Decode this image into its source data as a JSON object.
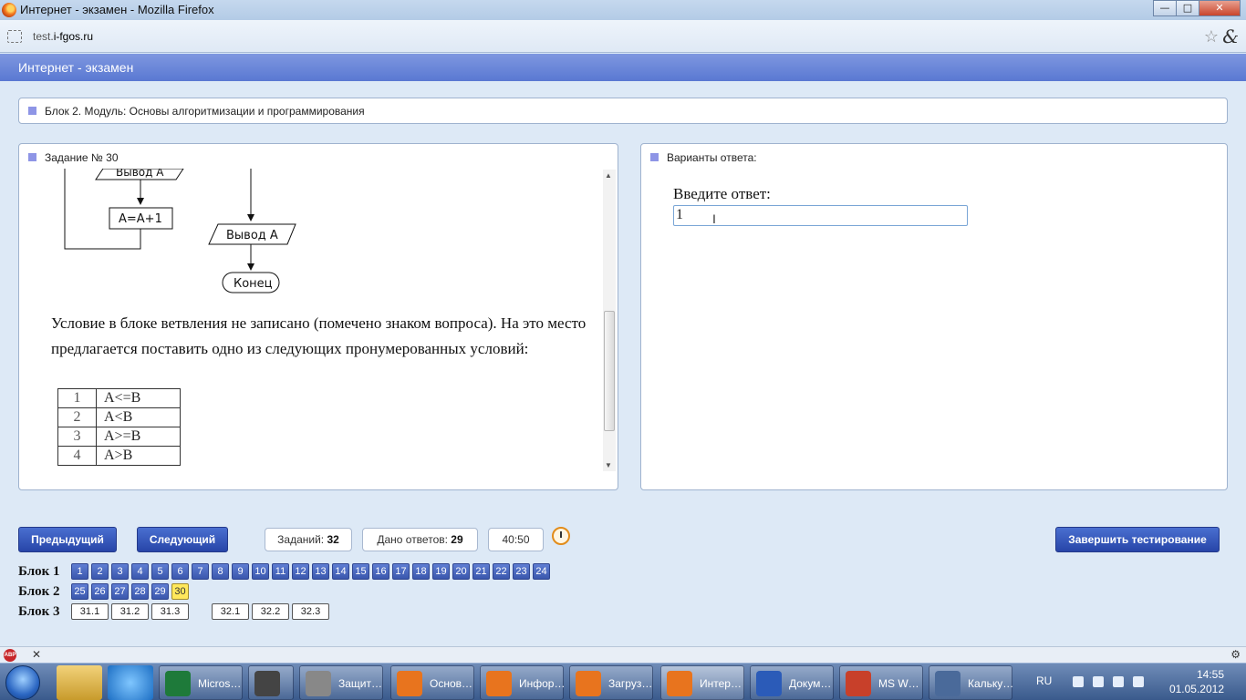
{
  "window": {
    "title": "Интернет - экзамен - Mozilla Firefox",
    "buttons": {
      "minimize": "—",
      "maximize": "□",
      "close": "✕"
    }
  },
  "browser": {
    "url_prefix": "test.",
    "url_domain": "i-fgos.ru"
  },
  "page": {
    "title": "Интернет - экзамен",
    "block_title": "Блок 2. Модуль: Основы алгоритмизации и программирования"
  },
  "task": {
    "title": "Задание № 30",
    "flowchart": {
      "output_top": "Вывод A",
      "assign": "A=A+1",
      "output": "Вывод A",
      "end": "Конец"
    },
    "text": "Условие в блоке ветвления не записано (помечено знаком вопроса). На это место предлагается поставить одно из следующих пронумерованных условий:",
    "conditions": [
      {
        "num": "1",
        "cond": "A<=B"
      },
      {
        "num": "2",
        "cond": "A<B"
      },
      {
        "num": "3",
        "cond": "A>=B"
      },
      {
        "num": "4",
        "cond": "A>B"
      }
    ]
  },
  "answer": {
    "title": "Варианты ответа:",
    "label": "Введите ответ:",
    "value": "1"
  },
  "nav": {
    "prev": "Предыдущий",
    "next": "Следующий",
    "tasks_label": "Заданий:",
    "tasks_count": "32",
    "answers_label": "Дано ответов:",
    "answers_count": "29",
    "timer": "40:50",
    "finish": "Завершить тестирование"
  },
  "blocks": [
    {
      "label": "Блок 1",
      "items": [
        "1",
        "2",
        "3",
        "4",
        "5",
        "6",
        "7",
        "8",
        "9",
        "10",
        "11",
        "12",
        "13",
        "14",
        "15",
        "16",
        "17",
        "18",
        "19",
        "20",
        "21",
        "22",
        "23",
        "24"
      ]
    },
    {
      "label": "Блок 2",
      "items": [
        "25",
        "26",
        "27",
        "28",
        "29",
        "30"
      ],
      "current": "30"
    },
    {
      "label": "Блок 3",
      "items": [
        "31.1",
        "31.2",
        "31.3",
        "32.1",
        "32.2",
        "32.3"
      ]
    }
  ],
  "addon": {
    "abp": "ABP",
    "close": "✕",
    "right": "⚙"
  },
  "taskbar": {
    "items": [
      {
        "label": "Micros…",
        "icon_color": "#1e7a3a"
      },
      {
        "label": "",
        "icon_color": "#444"
      },
      {
        "label": "Защит…",
        "icon_color": "#888"
      },
      {
        "label": "Основ…",
        "icon_color": "#e8741e"
      },
      {
        "label": "Инфор…",
        "icon_color": "#e8741e"
      },
      {
        "label": "Загруз…",
        "icon_color": "#e8741e"
      },
      {
        "label": "Интер…",
        "icon_color": "#e8741e"
      },
      {
        "label": "Докум…",
        "icon_color": "#2b5bb8"
      },
      {
        "label": "MS W…",
        "icon_color": "#c8402a"
      },
      {
        "label": "Кальку…",
        "icon_color": "#4a6a9a"
      }
    ],
    "lang": "RU",
    "time": "14:55",
    "date": "01.05.2012"
  }
}
